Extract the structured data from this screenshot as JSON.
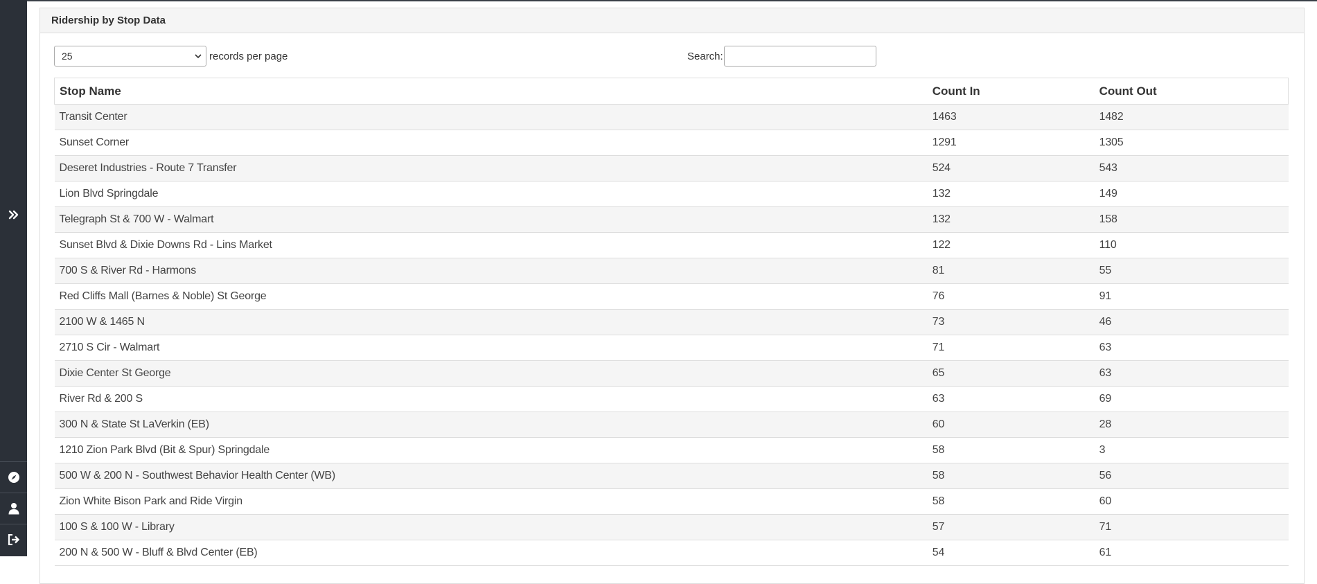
{
  "sidebar": {
    "expand_icon": "double-chevron-right-icon",
    "bottom_icons": [
      "compass-icon",
      "user-icon",
      "sign-out-icon"
    ]
  },
  "panel": {
    "title": "Ridership by Stop Data"
  },
  "controls": {
    "length_value": "25",
    "length_label": "records per page",
    "search_label": "Search:",
    "search_value": ""
  },
  "table": {
    "headers": [
      "Stop Name",
      "Count In",
      "Count Out"
    ],
    "rows": [
      [
        "Transit Center",
        "1463",
        "1482"
      ],
      [
        "Sunset Corner",
        "1291",
        "1305"
      ],
      [
        "Deseret Industries - Route 7 Transfer",
        "524",
        "543"
      ],
      [
        "Lion Blvd Springdale",
        "132",
        "149"
      ],
      [
        "Telegraph St & 700 W - Walmart",
        "132",
        "158"
      ],
      [
        "Sunset Blvd & Dixie Downs Rd - Lins Market",
        "122",
        "110"
      ],
      [
        "700 S & River Rd - Harmons",
        "81",
        "55"
      ],
      [
        "Red Cliffs Mall (Barnes & Noble) St George",
        "76",
        "91"
      ],
      [
        "2100 W & 1465 N",
        "73",
        "46"
      ],
      [
        "2710 S Cir - Walmart",
        "71",
        "63"
      ],
      [
        "Dixie Center St George",
        "65",
        "63"
      ],
      [
        "River Rd & 200 S",
        "63",
        "69"
      ],
      [
        "300 N & State St LaVerkin (EB)",
        "60",
        "28"
      ],
      [
        "1210 Zion Park Blvd (Bit & Spur) Springdale",
        "58",
        "3"
      ],
      [
        "500 W & 200 N - Southwest Behavior Health Center (WB)",
        "58",
        "56"
      ],
      [
        "Zion White Bison Park and Ride Virgin",
        "58",
        "60"
      ],
      [
        "100 S & 100 W - Library",
        "57",
        "71"
      ],
      [
        "200 N & 500 W - Bluff & Blvd Center (EB)",
        "54",
        "61"
      ]
    ]
  }
}
